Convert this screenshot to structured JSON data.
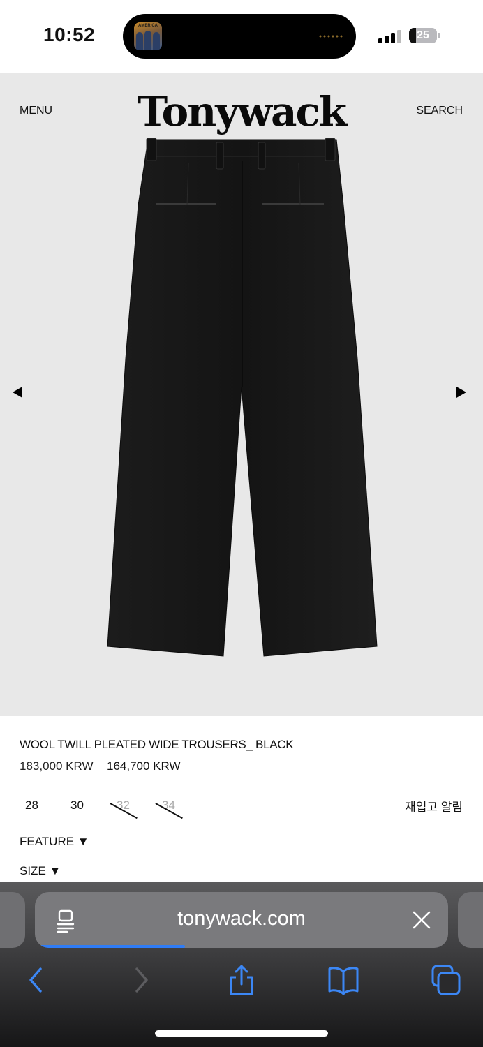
{
  "status_bar": {
    "time": "10:52",
    "battery": "25",
    "battery_level": 0.25,
    "now_playing_album_text": "AMERICA"
  },
  "header": {
    "menu_label": "MENU",
    "logo": "Tonywack",
    "search_label": "SEARCH"
  },
  "product": {
    "title": "WOOL TWILL PLEATED WIDE TROUSERS_ BLACK",
    "original_price": "183,000 KRW",
    "sale_price": "164,700 KRW",
    "sizes": [
      {
        "label": "28",
        "available": true
      },
      {
        "label": "30",
        "available": true
      },
      {
        "label": "32",
        "available": false
      },
      {
        "label": "34",
        "available": false
      }
    ],
    "restock_alert": "재입고 알림",
    "feature_toggle": "FEATURE ▼",
    "size_toggle": "SIZE ▼",
    "image_color": "#161616"
  },
  "browser": {
    "url": "tonywack.com",
    "load_progress": 0.35,
    "accent_color": "#2f7cf6"
  }
}
